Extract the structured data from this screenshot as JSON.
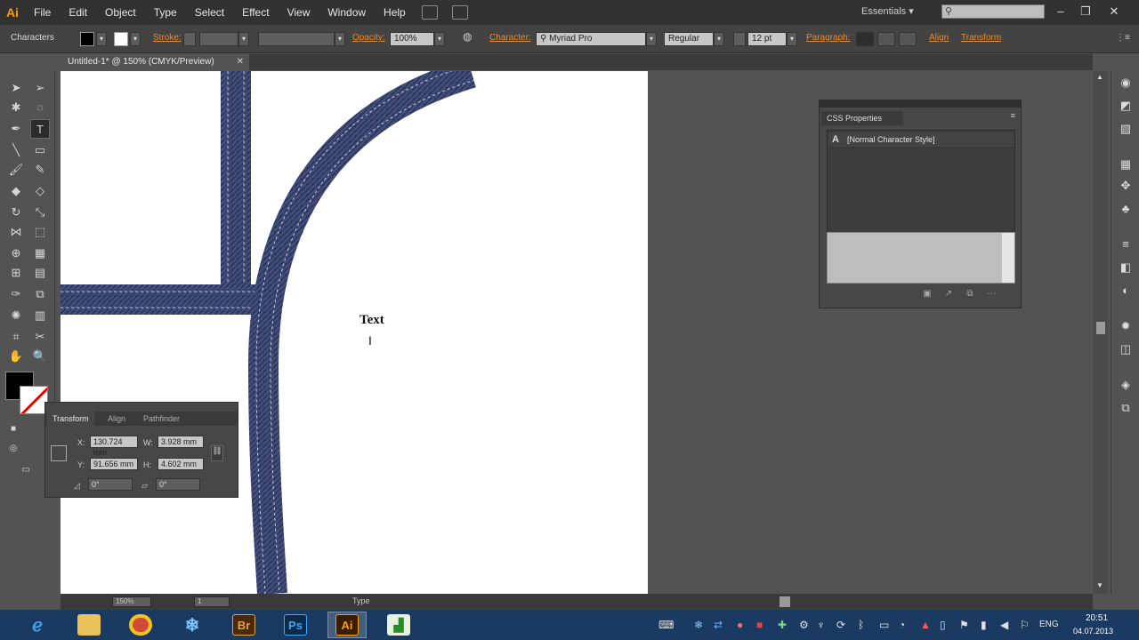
{
  "app": {
    "logo": "Ai",
    "menus": [
      "File",
      "Edit",
      "Object",
      "Type",
      "Select",
      "Effect",
      "View",
      "Window",
      "Help"
    ],
    "workspace": "Essentials",
    "search_placeholder": ""
  },
  "control_bar": {
    "selection_label": "Characters",
    "stroke_label": "Stroke:",
    "opacity_label": "Opacity:",
    "opacity_value": "100%",
    "character_label": "Character:",
    "font_family": "Myriad Pro",
    "font_style": "Regular",
    "font_size": "12 pt",
    "paragraph_label": "Paragraph:",
    "align_label": "Align",
    "transform_label": "Transform"
  },
  "document": {
    "tab_title": "Untitled-1* @ 150% (CMYK/Preview)",
    "text_object": "Text"
  },
  "css_panel": {
    "title": "CSS Properties",
    "styles": [
      "[Normal Character Style]"
    ]
  },
  "transform_panel": {
    "tabs": [
      "Transform",
      "Align",
      "Pathfinder"
    ],
    "x_label": "X:",
    "x_value": "130.724 mm",
    "y_label": "Y:",
    "y_value": "91.656 mm",
    "w_label": "W:",
    "w_value": "3.928 mm",
    "h_label": "H:",
    "h_value": "4.602 mm",
    "rotate_value": "0°",
    "shear_value": "0°"
  },
  "status_bar": {
    "zoom": "150%",
    "artboard": "1",
    "tool": "Type"
  },
  "taskbar": {
    "apps": [
      "Internet Explorer",
      "File Explorer",
      "Chrome",
      "Snowflake",
      "Br",
      "Ps",
      "Ai",
      "Chart"
    ],
    "language": "ENG",
    "time": "20:51",
    "date": "04.07.2013"
  },
  "colors": {
    "accent_orange": "#e8892b",
    "denim": "#3a4668",
    "taskbar": "#1a3a62"
  }
}
